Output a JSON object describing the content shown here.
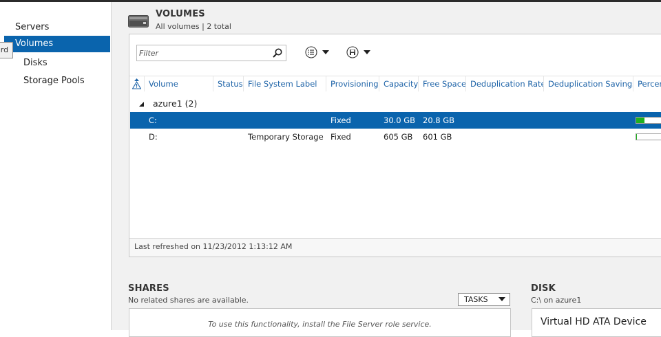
{
  "nav": {
    "items": [
      {
        "label": "Servers"
      },
      {
        "label": "Volumes"
      },
      {
        "label": "Disks"
      },
      {
        "label": "Storage Pools"
      }
    ],
    "selected_index": 1,
    "tooltip_fragment": "ard"
  },
  "volumes": {
    "title": "VOLUMES",
    "subtitle": "All volumes | 2 total",
    "filter_placeholder": "Filter",
    "columns": [
      "Volume",
      "Status",
      "File System Label",
      "Provisioning",
      "Capacity",
      "Free Space",
      "Deduplication Rate",
      "Deduplication Savings",
      "Percent"
    ],
    "group": {
      "label": "azure1 (2)"
    },
    "rows": [
      {
        "volume": "C:",
        "status": "",
        "label": "",
        "provisioning": "Fixed",
        "capacity": "30.0 GB",
        "free": "20.8 GB",
        "dedup_rate": "",
        "dedup_savings": "",
        "percent_used": 0.31,
        "selected": true
      },
      {
        "volume": "D:",
        "status": "",
        "label": "Temporary Storage",
        "provisioning": "Fixed",
        "capacity": "605 GB",
        "free": "601 GB",
        "dedup_rate": "",
        "dedup_savings": "",
        "percent_used": 0.01,
        "selected": false
      }
    ],
    "footer": "Last refreshed on 11/23/2012 1:13:12 AM"
  },
  "shares": {
    "title": "SHARES",
    "subtitle": "No related shares are available.",
    "tasks_label": "TASKS",
    "message": "To use this functionality, install the File Server role service."
  },
  "disk": {
    "title": "DISK",
    "subtitle": "C:\\ on azure1",
    "device": "Virtual HD ATA Device"
  },
  "colors": {
    "selection": "#0a64ad",
    "header_text": "#1f64a8",
    "usage_bar": "#1fb01f"
  }
}
